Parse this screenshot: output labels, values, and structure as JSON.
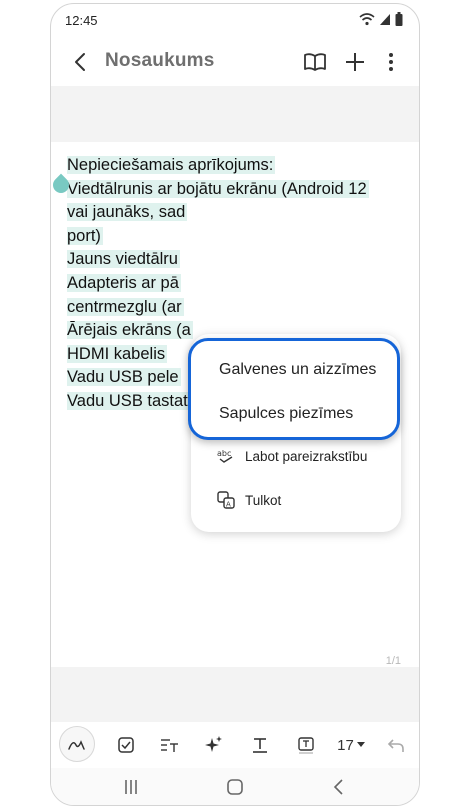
{
  "status": {
    "time": "12:45"
  },
  "appbar": {
    "title": "Nosaukums"
  },
  "note": {
    "lines": [
      "Nepieciešamais aprīkojums:",
      "Viedtālrunis ar bojātu ekrānu (Android 12",
      "vai jaunāks, sad",
      "port)",
      "Jauns viedtālru",
      "Adapteris ar pā",
      "centrmezglu (ar",
      "Ārējais ekrāns (a",
      "HDMI kabelis",
      "Vadu USB pele",
      "Vadu USB tastatūra"
    ],
    "page_indicator": "1/1"
  },
  "menu": {
    "highlighted": [
      "Galvenes un aizzīmes",
      "Sapulces piezīmes"
    ],
    "items": [
      {
        "label": "Labot pareizrakstību",
        "icon": "spell-check-icon"
      },
      {
        "label": "Tulkot",
        "icon": "translate-icon"
      }
    ]
  },
  "toolbar": {
    "font_size": "17"
  },
  "colors": {
    "selection": "#dff2ee",
    "highlight_border": "#1565d8",
    "handle_left": "#79c9c2",
    "handle_right": "#3d94e2"
  }
}
